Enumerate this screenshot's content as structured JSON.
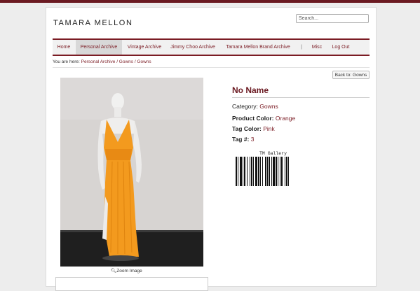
{
  "brand": {
    "logo_text": "TAMARA MELLON"
  },
  "search": {
    "placeholder": "Search..."
  },
  "nav": {
    "items": [
      {
        "label": "Home"
      },
      {
        "label": "Personal Archive"
      },
      {
        "label": "Vintage Archive"
      },
      {
        "label": "Jimmy Choo Archive"
      },
      {
        "label": "Tamara Mellon Brand Archive"
      },
      {
        "label": "|"
      },
      {
        "label": "Misc"
      },
      {
        "label": "Log Out"
      }
    ],
    "active_index": 1
  },
  "breadcrumb": {
    "prefix": "You are here:",
    "link": "Personal Archive / Gowns / Gowns"
  },
  "back_button": {
    "label": "Back to: Gowns"
  },
  "item": {
    "name": "No Name",
    "category_label": "Category:",
    "category_value": "Gowns",
    "product_color_label": "Product Color:",
    "product_color_value": "Orange",
    "tag_color_label": "Tag Color:",
    "tag_color_value": "Pink",
    "tag_num_label": "Tag #:",
    "tag_num_value": "3"
  },
  "zoom": {
    "label": "Zoom Image"
  },
  "barcode": {
    "label": "TM Gallery"
  },
  "colors": {
    "accent": "#7b1c24",
    "dress": "#f39a1e"
  }
}
